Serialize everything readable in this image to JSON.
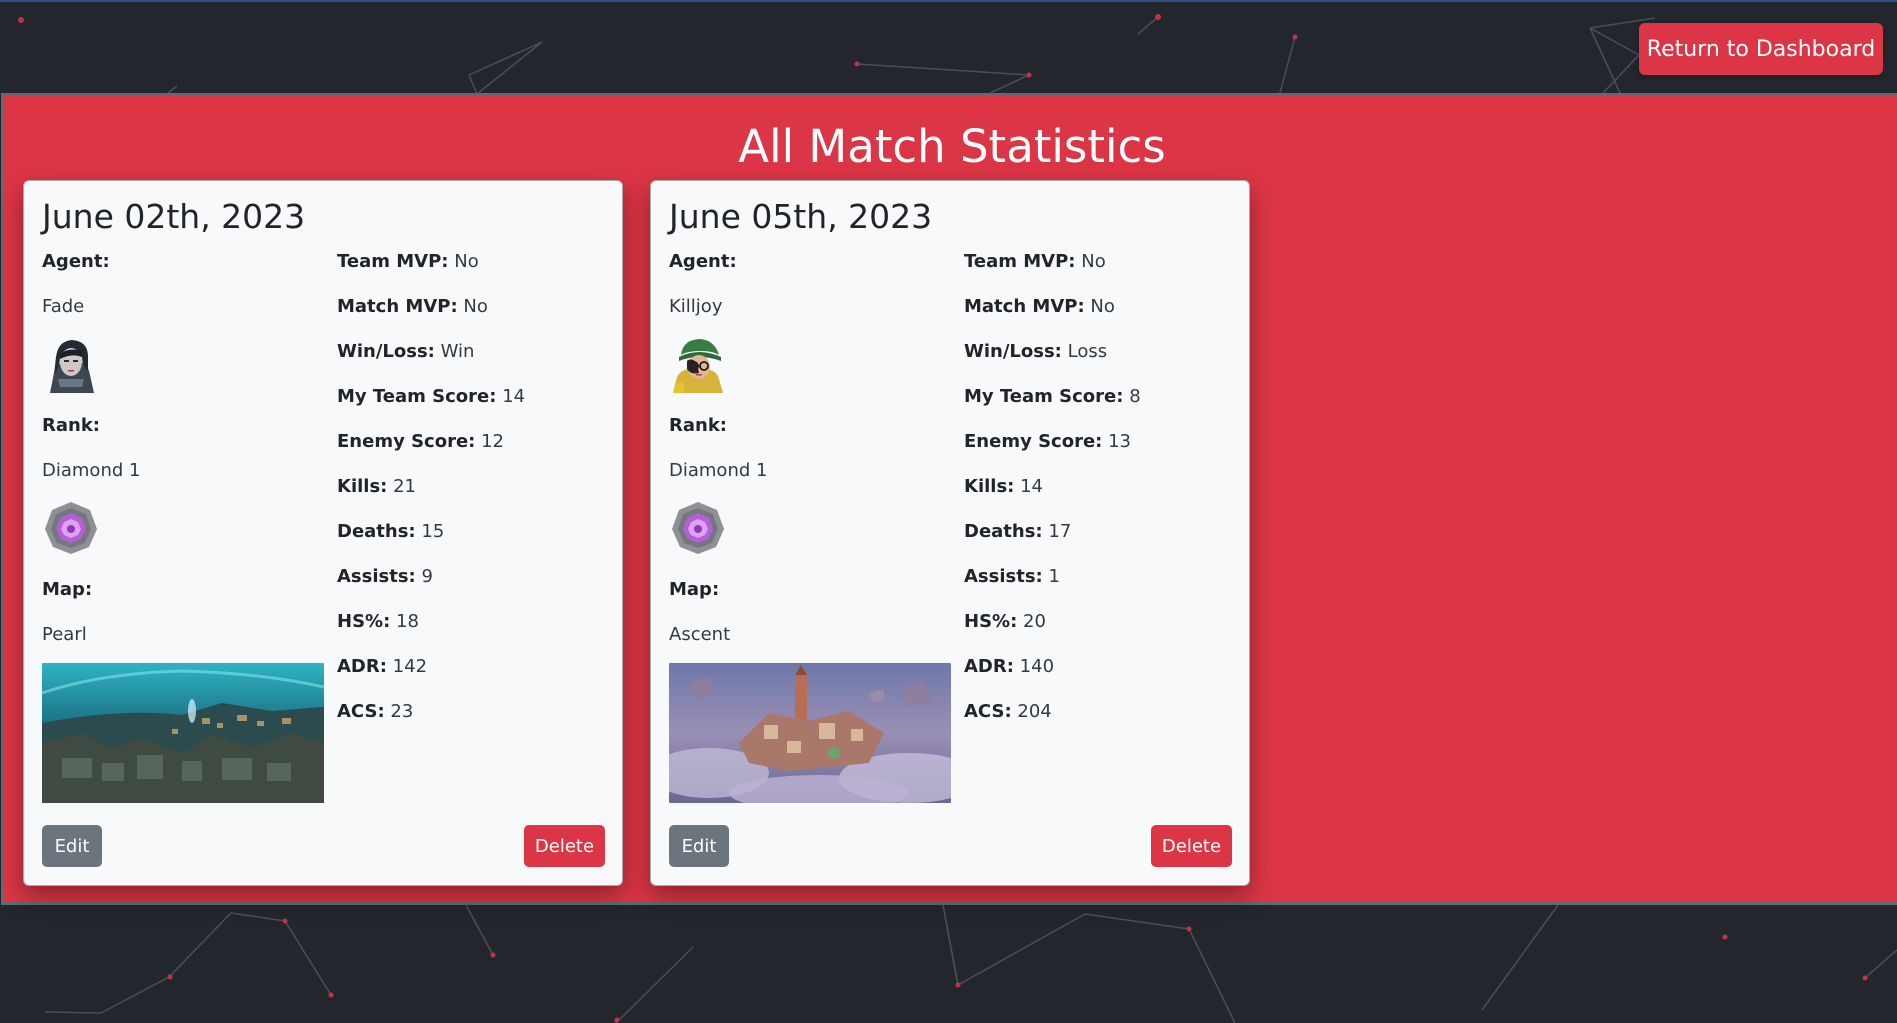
{
  "header": {
    "dashboard_button": "Return to Dashboard"
  },
  "title": "All Match Statistics",
  "labels": {
    "agent": "Agent:",
    "rank": "Rank:",
    "map": "Map:",
    "team_mvp": "Team MVP:",
    "match_mvp": "Match MVP:",
    "win_loss": "Win/Loss:",
    "my_team_score": "My Team Score:",
    "enemy_score": "Enemy Score:",
    "kills": "Kills:",
    "deaths": "Deaths:",
    "assists": "Assists:",
    "hs": "HS%:",
    "adr": "ADR:",
    "acs": "ACS:",
    "edit": "Edit",
    "delete": "Delete"
  },
  "matches": [
    {
      "date": "June 02th, 2023",
      "agent": "Fade",
      "agent_icon": "fade-agent-portrait",
      "rank": "Diamond 1",
      "rank_icon": "diamond-rank-icon",
      "map": "Pearl",
      "map_image": "pearl-map-image",
      "team_mvp": "No",
      "match_mvp": "No",
      "win_loss": "Win",
      "my_team_score": "14",
      "enemy_score": "12",
      "kills": "21",
      "deaths": "15",
      "assists": "9",
      "hs": "18",
      "adr": "142",
      "acs": "23"
    },
    {
      "date": "June 05th, 2023",
      "agent": "Killjoy",
      "agent_icon": "killjoy-agent-portrait",
      "rank": "Diamond 1",
      "rank_icon": "diamond-rank-icon",
      "map": "Ascent",
      "map_image": "ascent-map-image",
      "team_mvp": "No",
      "match_mvp": "No",
      "win_loss": "Loss",
      "my_team_score": "8",
      "enemy_score": "13",
      "kills": "14",
      "deaths": "17",
      "assists": "1",
      "hs": "20",
      "adr": "140",
      "acs": "204"
    }
  ],
  "colors": {
    "background": "#23262d",
    "panel": "#dc3545",
    "card": "#f8f9fa",
    "edit_button": "#6c757d",
    "delete_button": "#dc3545"
  }
}
